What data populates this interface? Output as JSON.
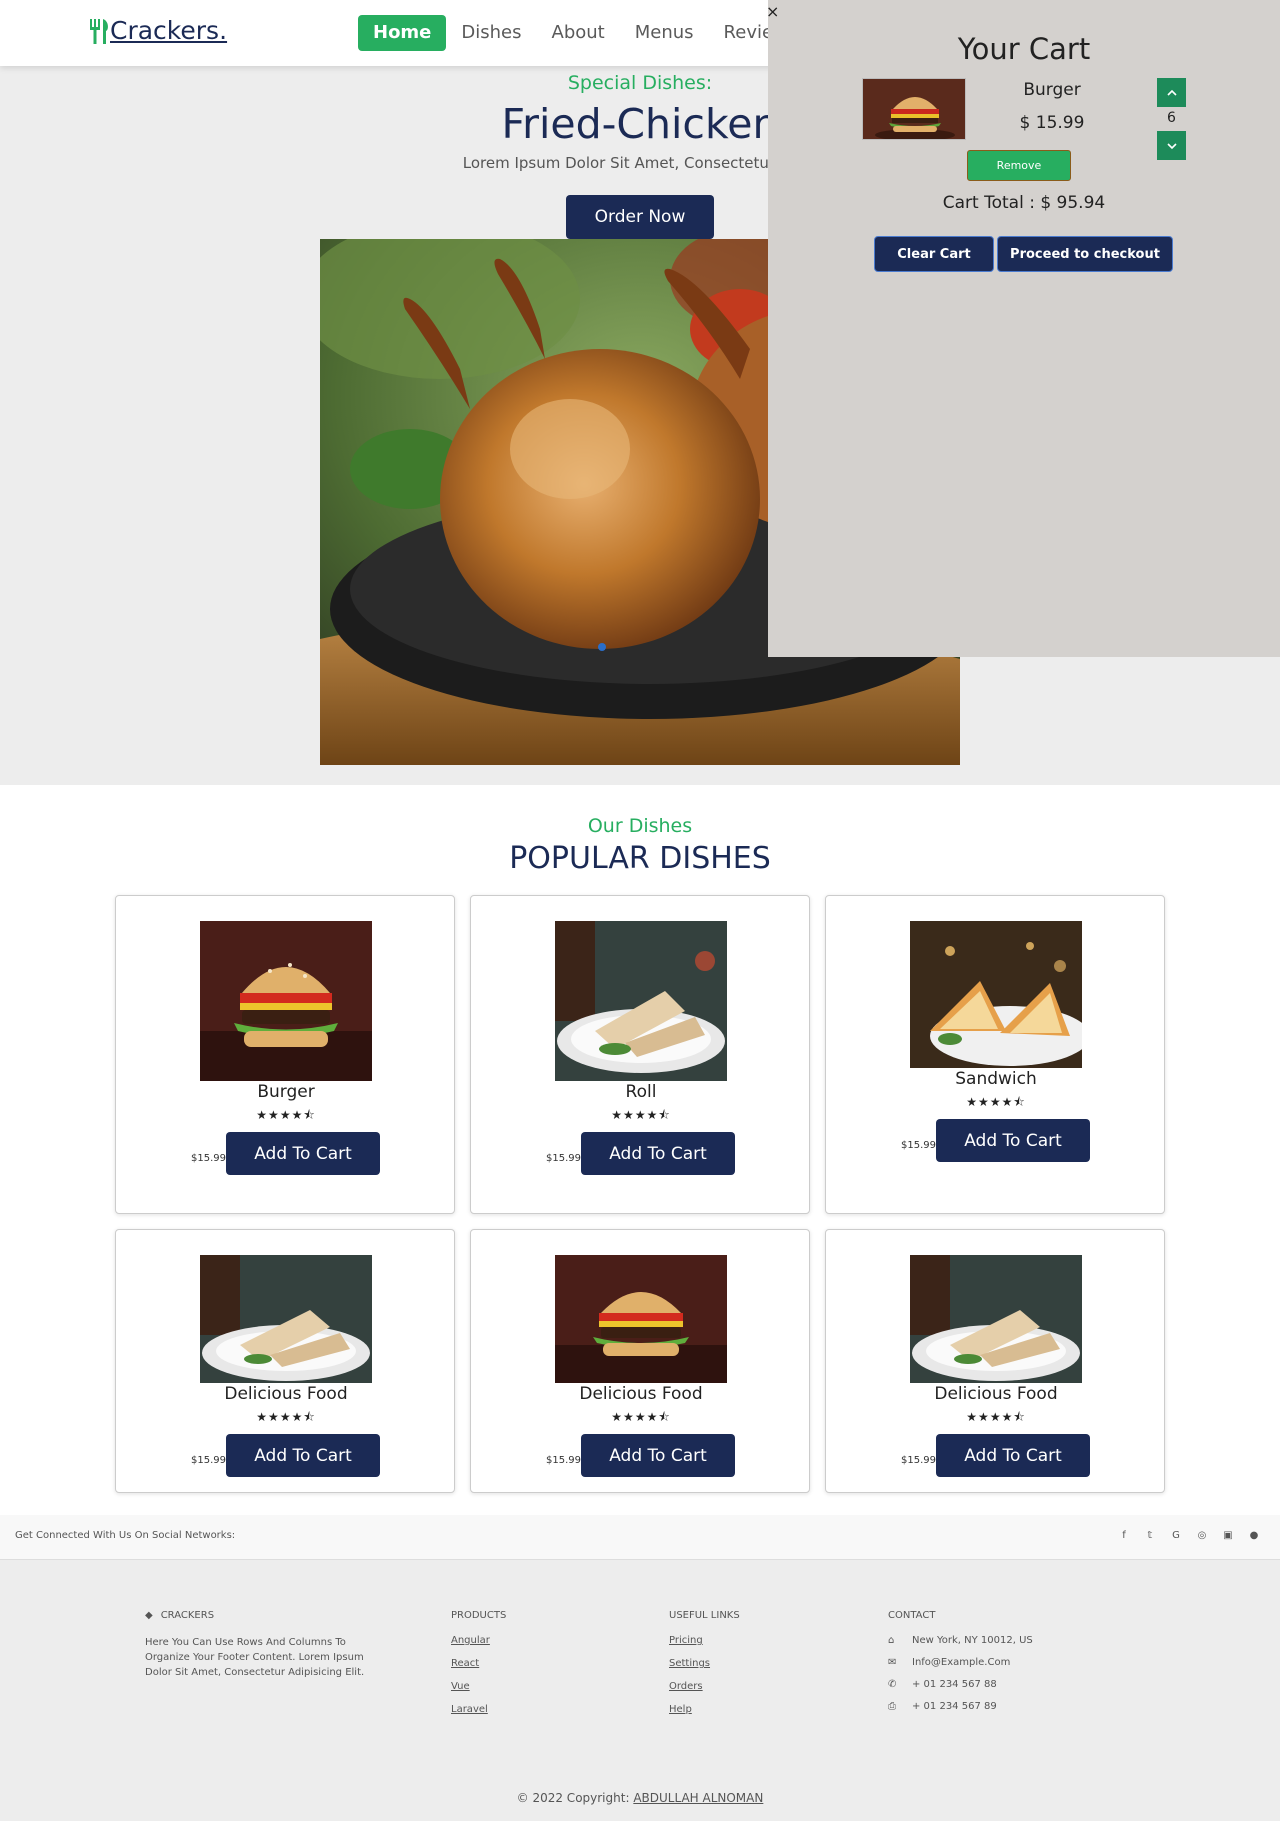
{
  "header": {
    "logo_text": "Crackers.",
    "nav": [
      "Home",
      "Dishes",
      "About",
      "Menus",
      "Review"
    ],
    "active_nav": "Home",
    "colors": {
      "accent": "#27ae60",
      "navy": "#1b2a55"
    }
  },
  "hero": {
    "subtitle": "Special Dishes:",
    "title": "Fried-Chicken",
    "description": "Lorem Ipsum Dolor Sit Amet, Consectetur Adipi",
    "order_button": "Order Now"
  },
  "cart": {
    "close_label": "×",
    "title": "Your Cart",
    "item_name": "Burger",
    "item_price": "$ 15.99",
    "quantity": "6",
    "remove_label": "Remove",
    "total": "Cart Total : $ 95.94",
    "clear_label": "Clear Cart",
    "checkout_label": "Proceed to checkout"
  },
  "dishes": {
    "subtitle": "Our Dishes",
    "title": "POPULAR DISHES",
    "cards": [
      {
        "name": "Burger",
        "price": "$15.99",
        "button": "Add To Cart",
        "rating": 4.5
      },
      {
        "name": "Roll",
        "price": "$15.99",
        "button": "Add To Cart",
        "rating": 4.5
      },
      {
        "name": "Sandwich",
        "price": "$15.99",
        "button": "Add To Cart",
        "rating": 4.5
      },
      {
        "name": "Delicious Food",
        "price": "$15.99",
        "button": "Add To Cart",
        "rating": 4.5
      },
      {
        "name": "Delicious Food",
        "price": "$15.99",
        "button": "Add To Cart",
        "rating": 4.5
      },
      {
        "name": "Delicious Food",
        "price": "$15.99",
        "button": "Add To Cart",
        "rating": 4.5
      }
    ]
  },
  "social": {
    "text": "Get Connected With Us On Social Networks:",
    "icons": [
      "facebook-icon",
      "twitter-icon",
      "google-icon",
      "instagram-icon",
      "linkedin-icon",
      "github-icon"
    ]
  },
  "footer": {
    "brand": "CRACKERS",
    "about": "Here You Can Use Rows And Columns To Organize Your Footer Content. Lorem Ipsum Dolor Sit Amet, Consectetur Adipisicing Elit.",
    "products_head": "PRODUCTS",
    "products": [
      "Angular",
      "React",
      "Vue",
      "Laravel"
    ],
    "links_head": "USEFUL LINKS",
    "links": [
      "Pricing",
      "Settings",
      "Orders",
      "Help"
    ],
    "contact_head": "CONTACT",
    "contact": [
      "New York, NY 10012, US",
      "Info@Example.Com",
      "+ 01 234 567 88",
      "+ 01 234 567 89"
    ],
    "copyright_prefix": "© 2022 Copyright:",
    "copyright_name": "ABDULLAH ALNOMAN"
  }
}
